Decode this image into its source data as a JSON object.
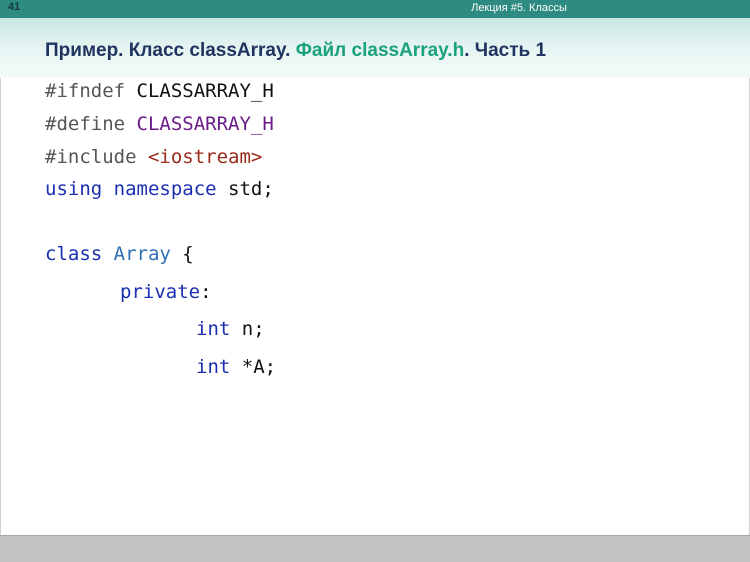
{
  "header": {
    "slide_number": "41",
    "lecture": "Лекция #5. Классы"
  },
  "title": {
    "part1": "Пример. Класс classArray. ",
    "part2": "Файл classArray.h",
    "part3": ". Часть 1"
  },
  "code": {
    "l1_directive": "#ifndef",
    "l1_macro": " CLASSARRAY_H",
    "l2_directive": "#define",
    "l2_macro": " CLASSARRAY_H",
    "l3_directive": "#include",
    "l3_header": " <iostream>",
    "l4_using": "using",
    "l4_namespace": " namespace",
    "l4_std": " std;",
    "l5_class": "class",
    "l5_name": " Array",
    "l5_brace": " {",
    "l6_private": "private",
    "l6_colon": ":",
    "l7_int": "int",
    "l7_rest": " n;",
    "l8_int": "int",
    "l8_rest": " *A;"
  }
}
